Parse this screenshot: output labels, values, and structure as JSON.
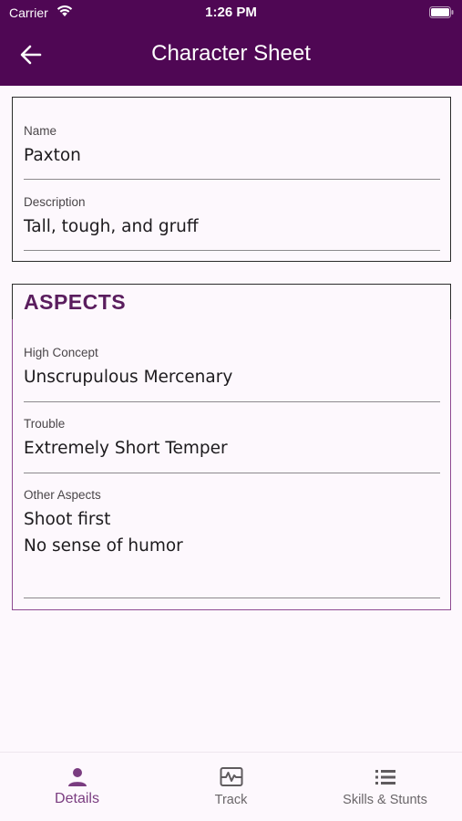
{
  "status_bar": {
    "carrier": "Carrier",
    "time": "1:26 PM"
  },
  "app_bar": {
    "title": "Character Sheet",
    "back_icon": "arrow-left-icon"
  },
  "identity": {
    "name_label": "Name",
    "name_value": "Paxton",
    "description_label": "Description",
    "description_value": "Tall, tough, and gruff"
  },
  "aspects": {
    "heading": "ASPECTS",
    "high_concept_label": "High Concept",
    "high_concept_value": "Unscrupulous Mercenary",
    "trouble_label": "Trouble",
    "trouble_value": "Extremely Short Temper",
    "other_label": "Other Aspects",
    "other_values": [
      "Shoot first",
      "No sense of humor"
    ]
  },
  "bottom_nav": {
    "items": [
      {
        "label": "Details",
        "icon": "person-icon",
        "active": true
      },
      {
        "label": "Track",
        "icon": "track-chart-icon",
        "active": false
      },
      {
        "label": "Skills & Stunts",
        "icon": "list-icon",
        "active": false
      }
    ]
  },
  "colors": {
    "app_bar": "#4f0754",
    "accent": "#7a3c80",
    "aspects_border": "#8e4a92",
    "background": "#fdf8fd"
  }
}
